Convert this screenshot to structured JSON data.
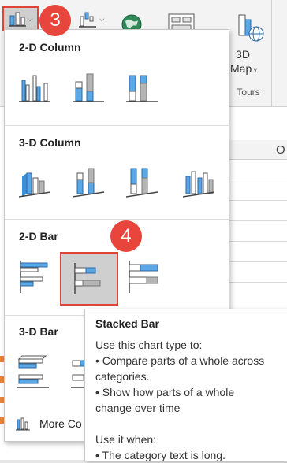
{
  "ribbon": {
    "map3d_line1": "3D",
    "map3d_line2": "Map",
    "map3d_chevron": "˅",
    "tours_label": "Tours",
    "icons": [
      "column-chart-icon",
      "waterfall-chart-icon",
      "globe-map-icon",
      "pivot-chart-icon",
      "3d-map-icon"
    ]
  },
  "sheet": {
    "column_header": "O"
  },
  "callouts": {
    "step3": "3",
    "step4": "4"
  },
  "panel": {
    "sections": [
      {
        "title": "2-D Column"
      },
      {
        "title": "3-D Column"
      },
      {
        "title": "2-D Bar"
      },
      {
        "title": "3-D Bar"
      }
    ],
    "more_label": "More Co"
  },
  "tooltip": {
    "title": "Stacked Bar",
    "line1": "Use this chart type to:",
    "line2": "• Compare parts of a whole across",
    "line3": "categories.",
    "line4": "• Show how parts of a whole",
    "line5": "change over time",
    "line6": "Use it when:",
    "line7": "• The category text is long."
  },
  "colors": {
    "accent_blue": "#5aa7e6",
    "gray_bar": "#b5b5b5",
    "callout_red": "#e8453c"
  }
}
